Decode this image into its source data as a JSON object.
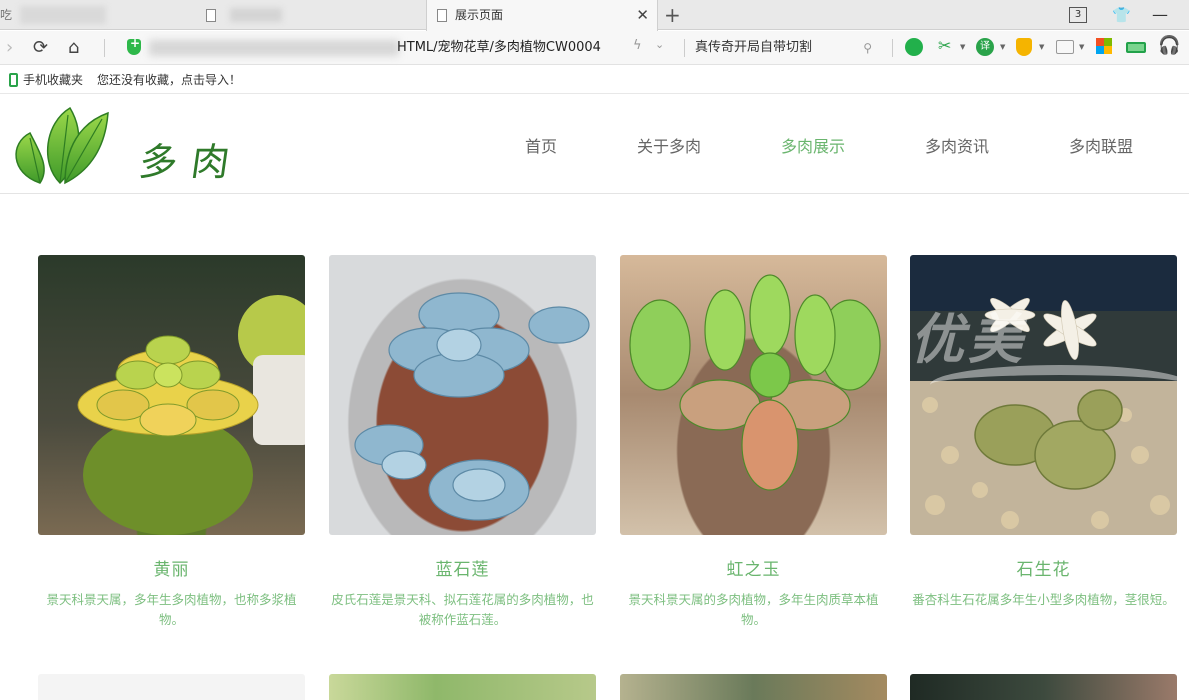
{
  "browser": {
    "tabs": [
      {
        "label": "吃"
      },
      {
        "label": ""
      },
      {
        "label": "展示页面"
      }
    ],
    "tab_count_badge": "3",
    "url_visible": "HTML/宠物花草/多肉植物CW0004",
    "search_text": "真传奇开局自带切割",
    "bookmarks": {
      "mobile_label": "手机收藏夹",
      "empty_hint": "您还没有收藏，点击导入！"
    }
  },
  "site": {
    "logo_text": "多肉",
    "nav": [
      {
        "label": "首页"
      },
      {
        "label": "关于多肉"
      },
      {
        "label": "多肉展示",
        "active": true
      },
      {
        "label": "多肉资讯"
      },
      {
        "label": "多肉联盟"
      }
    ],
    "watermark": "优美",
    "products": [
      {
        "name": "黄丽",
        "desc": "景天科景天属，多年生多肉植物，也称多浆植物。"
      },
      {
        "name": "蓝石莲",
        "desc": "皮氏石莲是景天科、拟石莲花属的多肉植物，也被称作蓝石莲。"
      },
      {
        "name": "虹之玉",
        "desc": "景天科景天属的多肉植物，多年生肉质草本植物。"
      },
      {
        "name": "石生花",
        "desc": "番杏科生石花属多年生小型多肉植物，茎很短。"
      }
    ]
  },
  "colors": {
    "accent_green": "#6ab56e",
    "desc_green": "#7dbf80",
    "nav_gray": "#666666"
  }
}
